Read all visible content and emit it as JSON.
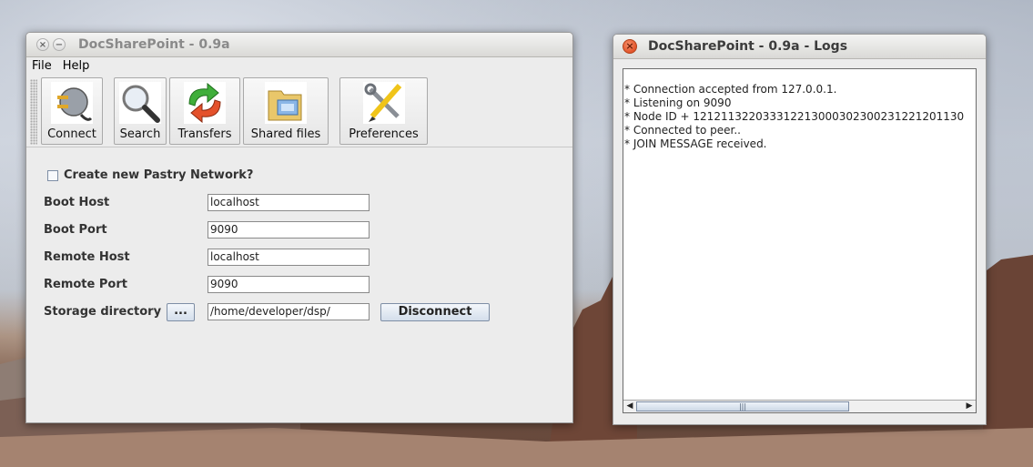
{
  "main_window": {
    "title": "DocSharePoint - 0.9a",
    "menu": [
      "File",
      "Help"
    ],
    "toolbar": [
      {
        "label": "Connect",
        "icon": "plug-icon"
      },
      {
        "label": "Search",
        "icon": "magnifier-icon"
      },
      {
        "label": "Transfers",
        "icon": "transfer-arrows-icon"
      },
      {
        "label": "Shared files",
        "icon": "folder-icon"
      },
      {
        "label": "Preferences",
        "icon": "tools-icon"
      }
    ],
    "form": {
      "create_network_label": "Create new Pastry Network?",
      "create_network_checked": false,
      "boot_host_label": "Boot Host",
      "boot_host_value": "localhost",
      "boot_port_label": "Boot Port",
      "boot_port_value": "9090",
      "remote_host_label": "Remote Host",
      "remote_host_value": "localhost",
      "remote_port_label": "Remote Port",
      "remote_port_value": "9090",
      "storage_label": "Storage directory",
      "browse_label": "...",
      "storage_value": "/home/developer/dsp/",
      "disconnect_label": "Disconnect"
    }
  },
  "log_window": {
    "title": "DocSharePoint - 0.9a - Logs",
    "lines": [
      "* Connection accepted from 127.0.0.1.",
      "* Listening on 9090",
      "* Node ID + 121211322033312213000302300231221201130",
      "* Connected to peer..",
      "* JOIN MESSAGE received."
    ],
    "scroll_thumb_glyph": "|||"
  }
}
